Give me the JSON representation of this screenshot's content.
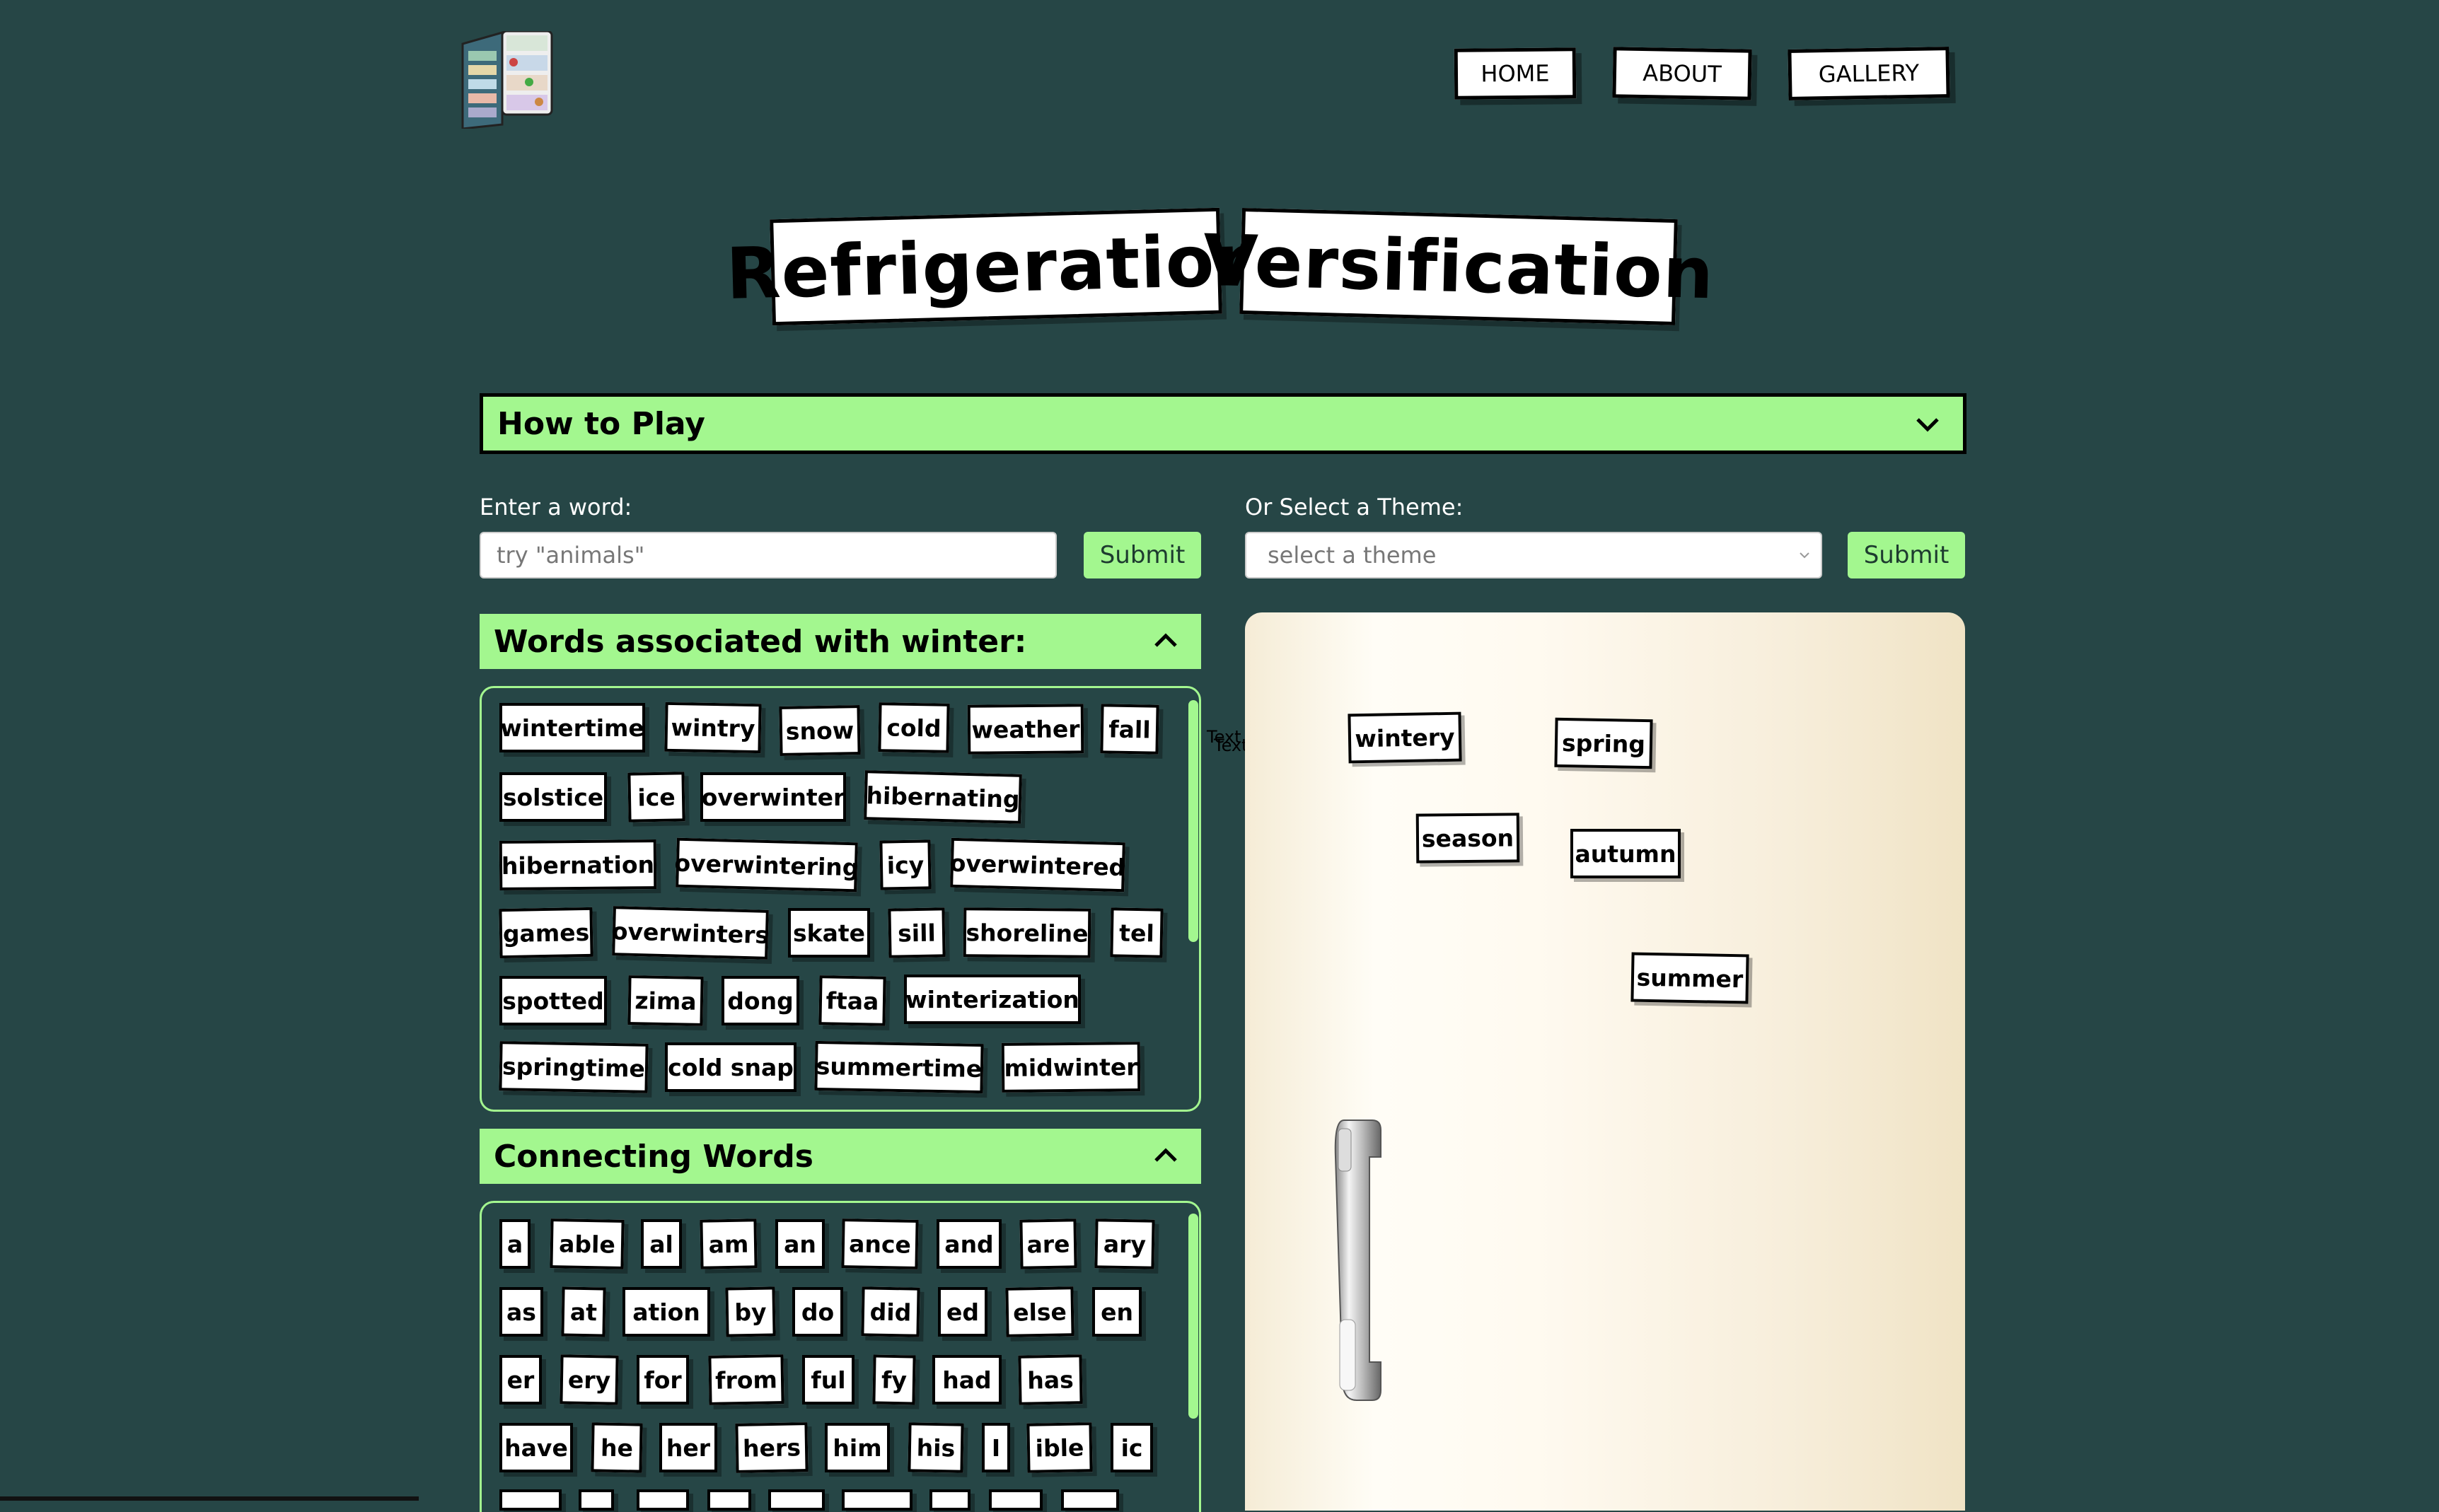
{
  "nav": {
    "home": "HOME",
    "about": "ABOUT",
    "gallery": "GALLERY"
  },
  "title": {
    "word1": "Refrigeration",
    "word2": "Versification"
  },
  "how_to_play": {
    "label": "How to Play"
  },
  "word_entry": {
    "label": "Enter a word:",
    "placeholder": "try \"animals\"",
    "submit": "Submit"
  },
  "theme_select": {
    "label": "Or Select a Theme:",
    "selected": "select a theme",
    "submit": "Submit"
  },
  "associated": {
    "header": "Words associated with winter:",
    "words": [
      "wintertime",
      "wintry",
      "snow",
      "cold",
      "weather",
      "fall",
      "solstice",
      "ice",
      "overwinter",
      "hibernating",
      "hibernation",
      "overwintering",
      "icy",
      "overwintered",
      "games",
      "overwinters",
      "skate",
      "sill",
      "shoreline",
      "tel",
      "spotted",
      "zima",
      "dong",
      "ftaa",
      "winterization",
      "springtime",
      "cold snap",
      "summertime",
      "midwinter"
    ]
  },
  "connecting": {
    "header": "Connecting Words",
    "words": [
      "a",
      "able",
      "al",
      "am",
      "an",
      "ance",
      "and",
      "are",
      "ary",
      "as",
      "at",
      "ation",
      "by",
      "do",
      "did",
      "ed",
      "else",
      "en",
      "er",
      "ery",
      "for",
      "from",
      "ful",
      "fy",
      "had",
      "has",
      "have",
      "he",
      "her",
      "hers",
      "him",
      "his",
      "I",
      "ible",
      "ic"
    ]
  },
  "stray_text": [
    "Text",
    "Text"
  ],
  "fridge": {
    "magnets": [
      "wintery",
      "spring",
      "season",
      "autumn",
      "summer"
    ]
  },
  "colors": {
    "background": "#264646",
    "accent": "#a3f78f",
    "fridge": "#fffaf0"
  }
}
